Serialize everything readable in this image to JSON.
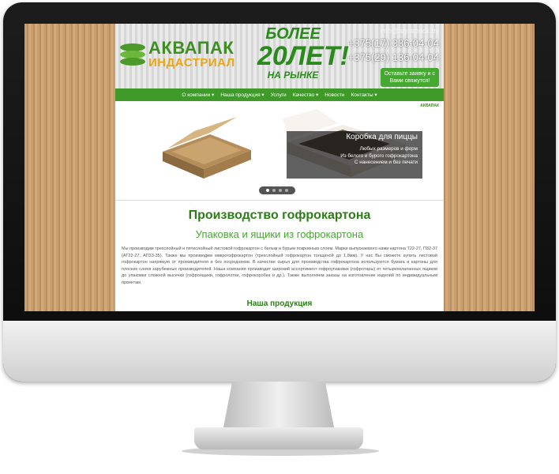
{
  "header": {
    "logo_name": "АКВАПАК",
    "logo_sub": "ИНДАСТРИАЛ",
    "promo_line1": "БОЛЕЕ",
    "promo_line2": "20ЛЕТ!",
    "promo_line3": "НА РЫНКЕ",
    "email": "info@aquapack.by",
    "phone1": "+375(17) 336-04-04",
    "phone2": "+375(29) 136-04-04",
    "callback_line1": "Оставьте заявку и с",
    "callback_line2": "Вами свяжутся!"
  },
  "nav": {
    "items": [
      {
        "label": "О компании ▾"
      },
      {
        "label": "Наша продукция ▾"
      },
      {
        "label": "Услуги"
      },
      {
        "label": "Качество ▾"
      },
      {
        "label": "Новости"
      },
      {
        "label": "Контакты ▾"
      }
    ]
  },
  "slider": {
    "mini_logo": "АКВАПАК",
    "caption_title": "Коробка для пиццы",
    "caption_lines": [
      "Любых размеров и форм",
      "Из белого и бурого гофрокартона",
      "С нанесением и без печати"
    ]
  },
  "content": {
    "title": "Производство гофрокартона",
    "subtitle": "Упаковка и ящики из гофрокартона",
    "paragraph": "Мы производим трехслойный и пятислойный листовой гофрокартон с белым и бурым покровным слоем. Марки выпускаемого нами картона Т22-27, П32-37 (АТ22-27, АП33-35). Также мы производим микрогофрокартон (трехслойный гофрокартон толщиной до 1,8мм). У нас Вы сможете купить листовой гофрокартон напрямую от производителя и без посредников. В качестве сырья для производства гофрокартона используются бумага и картоны для плоских слоев зарубежных производителей. Наша компания производит широкий ассортимент гофроупаковки (гофротары) от четырехклапанных ящиков до упаковки сложной высечки (гофроящики, гофролотки, гофрокоробка и др.). Также выполняем заказы на изготовление изделий по индивидуальным проектам.",
    "section_heading": "Наша продукция"
  },
  "colors": {
    "brand_green": "#3f9a2a",
    "accent_orange": "#e8a614",
    "cardboard": "#c89f6e"
  }
}
